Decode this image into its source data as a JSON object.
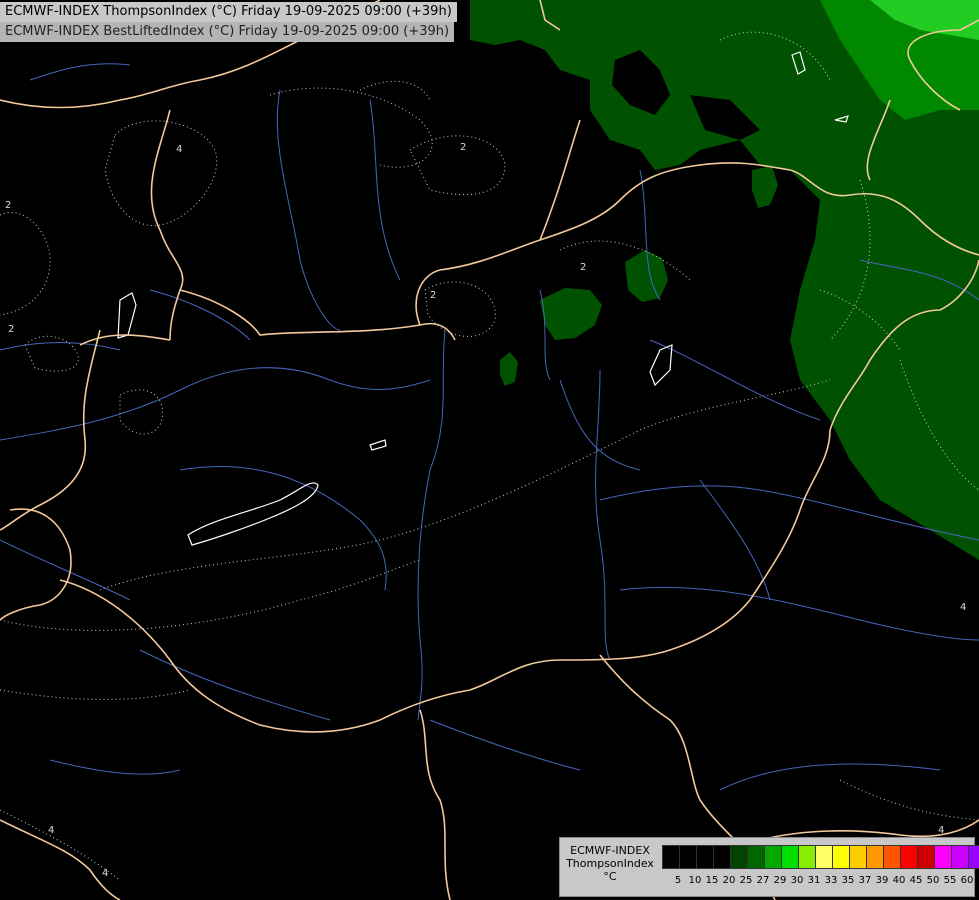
{
  "header": {
    "line1": "ECMWF-INDEX ThompsonIndex (°C) Friday 19-09-2025 09:00 (+39h)",
    "line2": "ECMWF-INDEX BestLiftedIndex (°C) Friday 19-09-2025 09:00 (+39h)"
  },
  "legend": {
    "model": "ECMWF-INDEX",
    "parameter": "ThompsonIndex",
    "unit": "°C",
    "colors": [
      "#000000",
      "#000000",
      "#000000",
      "#000000",
      "#004400",
      "#006600",
      "#00aa00",
      "#00dd00",
      "#88ee00",
      "#ffff66",
      "#ffff00",
      "#ffcc00",
      "#ff9900",
      "#ff5500",
      "#ff0000",
      "#cc0000",
      "#ff00ff",
      "#cc00ff",
      "#9900ff",
      "#6600ff",
      "#0000ff"
    ],
    "ticks": [
      "5",
      "10",
      "15",
      "20",
      "25",
      "27",
      "29",
      "30",
      "31",
      "33",
      "35",
      "37",
      "39",
      "40",
      "45",
      "50",
      "55",
      "60"
    ]
  },
  "contour_labels": [
    "4",
    "2",
    "2",
    "2",
    "2",
    "2",
    "4",
    "4",
    "4",
    "4"
  ]
}
